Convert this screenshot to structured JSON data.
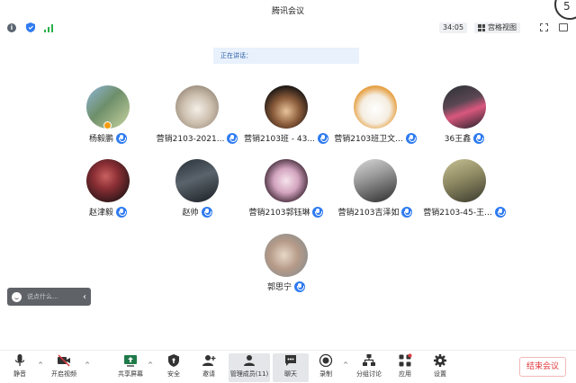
{
  "window": {
    "title": "腾讯会议",
    "corner_badge": "5"
  },
  "infobar": {
    "timer": "34:05",
    "view_mode": "宫格视图"
  },
  "speaking_banner": "正在讲话：",
  "participants": [
    {
      "name": "杨毅鹏",
      "avatar_bg": "linear-gradient(135deg,#8fb6d9 0%,#6e8f6a 45%,#c8d4a0 100%)",
      "host": true
    },
    {
      "name": "营销2103-2021...",
      "avatar_bg": "radial-gradient(circle at 50% 55%,#f3efe9 0%,#cdbfae 45%,#7a6b5d 100%)"
    },
    {
      "name": "营销2103班 - 43...",
      "avatar_bg": "radial-gradient(circle at 50% 60%,#e8c39a 0%,#8a5b3a 40%,#1e1815 75%)"
    },
    {
      "name": "营销2103班卫文...",
      "avatar_bg": "radial-gradient(circle at 50% 55%,#ffffff 0%,#f4ede1 45%,#e6a043 70%,#efe9de 100%)"
    },
    {
      "name": "36王鑫",
      "avatar_bg": "linear-gradient(160deg,#2b2f36 0%,#5a4753 40%,#d9577e 60%,#1c2024 100%)"
    },
    {
      "name": "赵津毅",
      "avatar_bg": "radial-gradient(circle at 45% 40%,#c96060 0%,#8b2f35 35%,#2a1618 80%)"
    },
    {
      "name": "赵帅",
      "avatar_bg": "linear-gradient(160deg,#283038 0%,#5a636b 45%,#1a1f24 100%)"
    },
    {
      "name": "营销2103郭钰琳",
      "avatar_bg": "radial-gradient(circle at 50% 50%,#f6e4ec 0%,#d3a4bf 40%,#4a3140 75%)"
    },
    {
      "name": "营销2103吉泽如",
      "avatar_bg": "linear-gradient(160deg,#d8d8d8 0%,#9a9a9a 40%,#2d2d2d 100%)"
    },
    {
      "name": "营销2103-45-王...",
      "avatar_bg": "linear-gradient(160deg,#c7c093 0%,#8f8a63 45%,#3a3a2e 100%)"
    },
    {
      "name": "郭思宁",
      "avatar_bg": "radial-gradient(circle at 45% 50%,#e8d8c8 0%,#b59a88 45%,#7a8a8f 100%)"
    }
  ],
  "chat": {
    "placeholder": "说点什么..."
  },
  "toolbar": {
    "mute": "静音",
    "video": "开启视频",
    "share": "共享屏幕",
    "security": "安全",
    "invite": "邀请",
    "members": "管理成员(11)",
    "chat": "聊天",
    "record": "录制",
    "breakout": "分组讨论",
    "apps": "应用",
    "settings": "设置",
    "end": "结束会议"
  },
  "colors": {
    "accent": "#2f7bf0",
    "end_red": "#e0393e"
  }
}
